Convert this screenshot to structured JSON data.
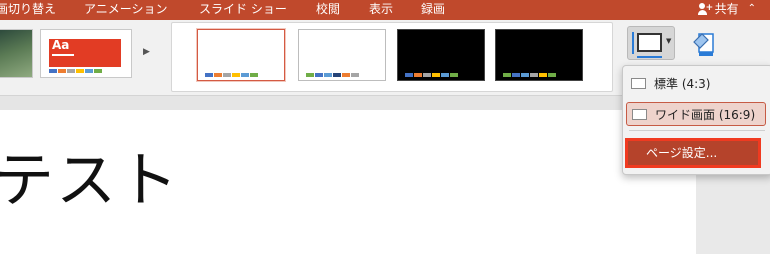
{
  "menubar": {
    "items": [
      "画切り替え",
      "アニメーション",
      "スライド ショー",
      "校閲",
      "表示",
      "録画"
    ],
    "share_label": "共有"
  },
  "ribbon": {
    "swatch_colors": [
      "#4472c4",
      "#ed7d31",
      "#a5a5a5",
      "#ffc000",
      "#5b9bd5",
      "#70ad47"
    ],
    "red_theme_sample": "Aa"
  },
  "slide": {
    "title_text": "テスト"
  },
  "slide_size_menu": {
    "items": [
      "標準 (4:3)",
      "ワイド画面 (16:9)"
    ],
    "page_setup_label": "ページ設定..."
  }
}
